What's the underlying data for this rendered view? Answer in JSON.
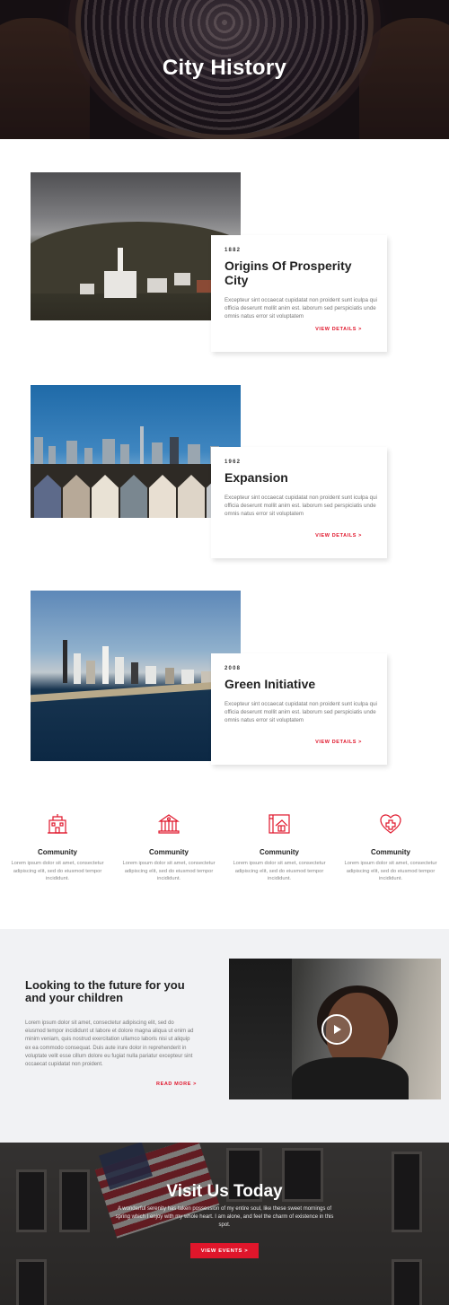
{
  "hero": {
    "title": "City History"
  },
  "timeline": [
    {
      "year": "1882",
      "title": "Origins Of Prosperity City",
      "text": "Excepteur sint occaecat cupidatat non proident sunt iculpa qui officia deserunt mollit anim est. laborum sed perspiciatis unde omnis natus error sit voluptatem",
      "link": "VIEW DETAILS >"
    },
    {
      "year": "1962",
      "title": "Expansion",
      "text": "Excepteur sint occaecat cupidatat non proident sunt iculpa qui officia deserunt mollit anim est. laborum sed perspiciatis unde omnis natus error sit voluptatem",
      "link": "VIEW DETAILS >"
    },
    {
      "year": "2008",
      "title": "Green Initiative",
      "text": "Excepteur sint occaecat cupidatat non proident sunt iculpa qui officia deserunt mollit anim est. laborum sed perspiciatis unde omnis natus error sit voluptatem",
      "link": "VIEW DETAILS >"
    }
  ],
  "features": [
    {
      "icon": "city-hall-icon",
      "title": "Community",
      "text": "Lorem ipsum dolor sit amet, consectetur adipiscing elit, sed do eiusmod tempor incididunt."
    },
    {
      "icon": "government-building-icon",
      "title": "Community",
      "text": "Lorem ipsum dolor sit amet, consectetur adipiscing elit, sed do eiusmod tempor incididunt."
    },
    {
      "icon": "house-plan-icon",
      "title": "Community",
      "text": "Lorem ipsum dolor sit amet, consectetur adipiscing elit, sed do eiusmod tempor incididunt."
    },
    {
      "icon": "health-heart-icon",
      "title": "Community",
      "text": "Lorem ipsum dolor sit amet, consectetur adipiscing elit, sed do eiusmod tempor incididunt."
    }
  ],
  "future": {
    "title": "Looking to the future for you and your children",
    "text": "Lorem ipsum dolor sit amet, consectetur adipiscing elit, sed do eiusmod tempor incididunt ut labore et dolore magna aliqua ut enim ad minim veniam, quis nostrud exercitation ullamco laboris nisi ut aliquip ex ea commodo consequat. Duis aute irure dolor in reprehenderit in voluptate velit esse cillum dolore eu fugiat nulla pariatur excepteur sint occaecat cupidatat non proident.",
    "link": "READ MORE >"
  },
  "visit": {
    "title": "Visit Us Today",
    "text": "A wonderful serenity has taken possession of my entire soul, like these sweet mornings of spring which I enjoy with my whole heart. I am alone, and feel the charm of existence in this spot.",
    "button": "VIEW EVENTS >"
  },
  "colors": {
    "accent": "#e0162b",
    "section_bg": "#f1f2f4"
  }
}
